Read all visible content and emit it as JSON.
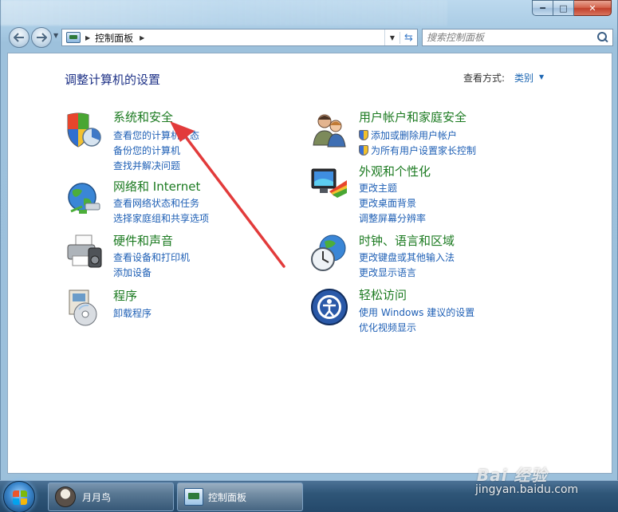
{
  "window": {
    "caption_buttons": {
      "minimize": "━",
      "maximize": "□",
      "close": "✕"
    }
  },
  "nav": {
    "back_icon": "back-arrow-icon",
    "forward_icon": "forward-arrow-icon",
    "breadcrumb": "控制面板",
    "search_placeholder": "搜索控制面板"
  },
  "header": {
    "title": "调整计算机的设置",
    "view_by_label": "查看方式:",
    "view_by_value": "类别"
  },
  "categories": [
    {
      "title": "系统和安全",
      "icon": "shield-pie-icon",
      "links": [
        "查看您的计算机状态",
        "备份您的计算机",
        "查找并解决问题"
      ]
    },
    {
      "title": "网络和 Internet",
      "icon": "globe-network-icon",
      "links": [
        "查看网络状态和任务",
        "选择家庭组和共享选项"
      ]
    },
    {
      "title": "硬件和声音",
      "icon": "printer-icon",
      "links": [
        "查看设备和打印机",
        "添加设备"
      ]
    },
    {
      "title": "程序",
      "icon": "programs-icon",
      "links": [
        "卸载程序"
      ]
    },
    {
      "title": "用户帐户和家庭安全",
      "icon": "users-icon",
      "links": [
        "添加或删除用户帐户",
        "为所有用户设置家长控制"
      ]
    },
    {
      "title": "外观和个性化",
      "icon": "monitor-palette-icon",
      "links": [
        "更改主题",
        "更改桌面背景",
        "调整屏幕分辨率"
      ]
    },
    {
      "title": "时钟、语言和区域",
      "icon": "clock-globe-icon",
      "links": [
        "更改键盘或其他输入法",
        "更改显示语言"
      ]
    },
    {
      "title": "轻松访问",
      "icon": "ease-of-access-icon",
      "links": [
        "使用 Windows 建议的设置",
        "优化视频显示"
      ]
    }
  ],
  "taskbar": {
    "items": [
      {
        "label": "月月鸟"
      },
      {
        "label": "控制面板"
      }
    ]
  },
  "watermark": {
    "logo": "Bai 经验",
    "url": "jingyan.baidu.com"
  },
  "colors": {
    "category_title": "#1b7a20",
    "link": "#1e5fb5",
    "heading": "#1e3287",
    "annotation_arrow": "#e23b3b"
  }
}
